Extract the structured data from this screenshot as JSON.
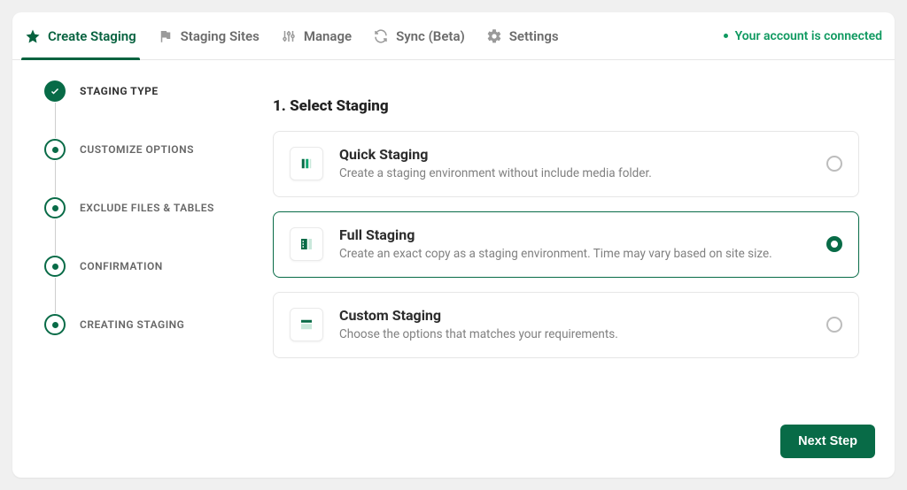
{
  "tabs": [
    {
      "label": "Create Staging",
      "icon": "star"
    },
    {
      "label": "Staging Sites",
      "icon": "flag"
    },
    {
      "label": "Manage",
      "icon": "sliders"
    },
    {
      "label": "Sync (Beta)",
      "icon": "refresh"
    },
    {
      "label": "Settings",
      "icon": "gear"
    }
  ],
  "status": {
    "label": "Your account is connected"
  },
  "steps": [
    {
      "label": "STAGING TYPE",
      "state": "complete"
    },
    {
      "label": "CUSTOMIZE OPTIONS",
      "state": "pending"
    },
    {
      "label": "EXCLUDE FILES & TABLES",
      "state": "pending"
    },
    {
      "label": "CONFIRMATION",
      "state": "pending"
    },
    {
      "label": "CREATING STAGING",
      "state": "pending"
    }
  ],
  "panel": {
    "title": "1. Select Staging",
    "options": [
      {
        "title": "Quick Staging",
        "desc": "Create a staging environment without include media folder.",
        "selected": false
      },
      {
        "title": "Full Staging",
        "desc": "Create an exact copy as a staging environment. Time may vary based on site size.",
        "selected": true
      },
      {
        "title": "Custom Staging",
        "desc": "Choose the options that matches your requirements.",
        "selected": false
      }
    ]
  },
  "buttons": {
    "next": "Next Step"
  }
}
